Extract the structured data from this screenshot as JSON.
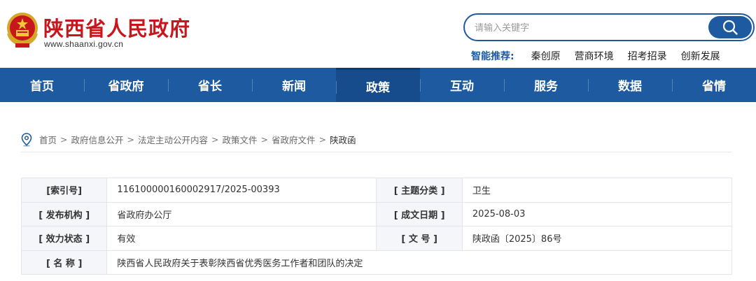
{
  "header": {
    "site_title": "陕西省人民政府",
    "site_url": "www.shaanxi.gov.cn",
    "search_placeholder": "请输入关键字",
    "smart_label": "智能推荐:",
    "smart_links": [
      "秦创原",
      "营商环境",
      "招考招录",
      "创新发展"
    ]
  },
  "nav": {
    "items": [
      "首页",
      "省政府",
      "省长",
      "新闻",
      "政策",
      "互动",
      "服务",
      "数据",
      "省情"
    ],
    "active_index": 4
  },
  "breadcrumb": [
    "首页",
    "政府信息公开",
    "法定主动公开内容",
    "政策文件",
    "省政府文件",
    "陕政函"
  ],
  "info": {
    "index_no_label": "[索引号]",
    "index_no": "116100000160002917/2025-00393",
    "topic_label": "[ 主题分类 ]",
    "topic": "卫生",
    "publisher_label": "[ 发布机构 ]",
    "publisher": "省政府办公厅",
    "date_label": "[ 成文日期 ]",
    "date": "2025-08-03",
    "status_label": "[ 效力状态 ]",
    "status": "有效",
    "doc_no_label": "[ 文 号 ]",
    "doc_no": "陕政函〔2025〕86号",
    "name_label": "[ 名 称 ]",
    "name": "陕西省人民政府关于表彰陕西省优秀医务工作者和团队的决定"
  },
  "colors": {
    "brand_red": "#c8161d",
    "nav_blue": "#1e5aa0",
    "nav_active": "#164c8c"
  }
}
